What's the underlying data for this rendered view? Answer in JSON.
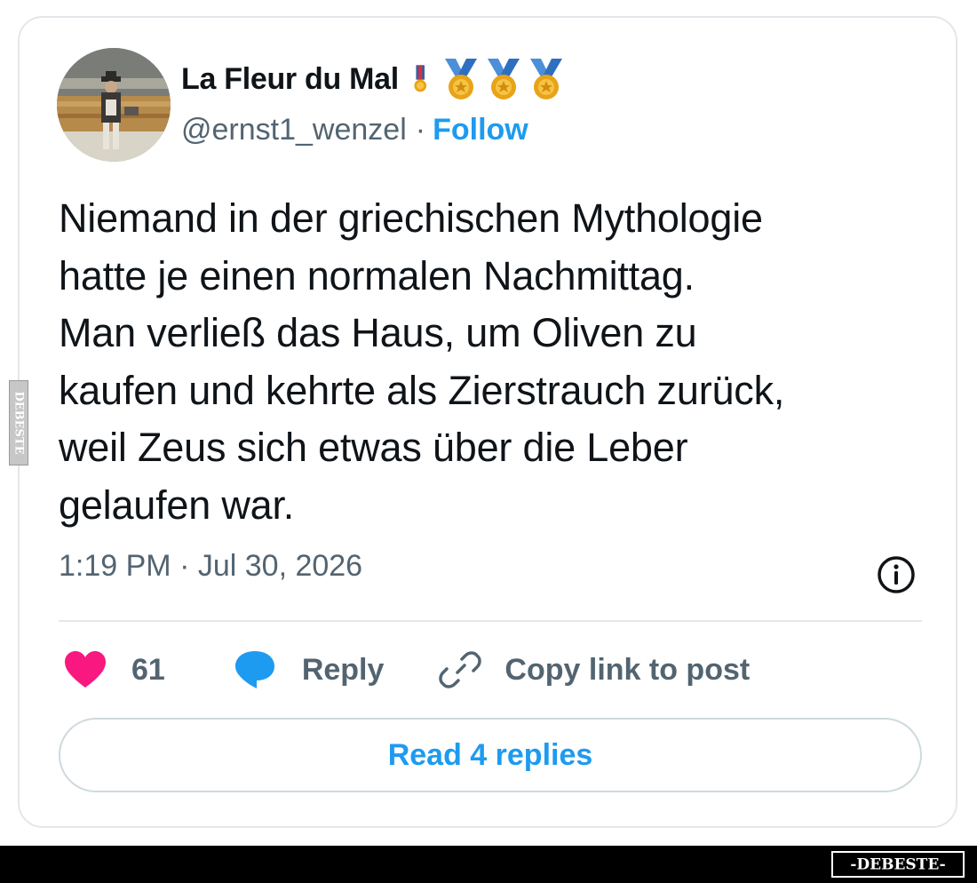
{
  "post": {
    "author": {
      "display_name": "La Fleur du Mal",
      "handle": "@ernst1_wenzel",
      "separator": "·",
      "follow_label": "Follow",
      "badges": [
        "military-medal-icon",
        "sports-medal-icon",
        "sports-medal-icon",
        "sports-medal-icon"
      ]
    },
    "text_lines": [
      "Niemand in der griechischen Mythologie",
      "hatte je einen normalen Nachmittag.",
      "Man verließ das Haus, um Oliven zu",
      "kaufen und kehrte als Zierstrauch zurück,",
      "weil Zeus sich etwas über die Leber",
      "gelaufen war."
    ],
    "timestamp": "1:19 PM · Jul 30, 2026",
    "actions": {
      "like_count": "61",
      "reply_label": "Reply",
      "copy_link_label": "Copy link to post"
    },
    "read_replies_label": "Read 4 replies"
  },
  "watermark": {
    "side_text": "DEBESTE",
    "bottom_text": "-DEBESTE-"
  },
  "colors": {
    "accent": "#1d9bf0",
    "like": "#f91880",
    "text": "#0f1419",
    "muted": "#536471",
    "border": "#e3e7eb"
  }
}
